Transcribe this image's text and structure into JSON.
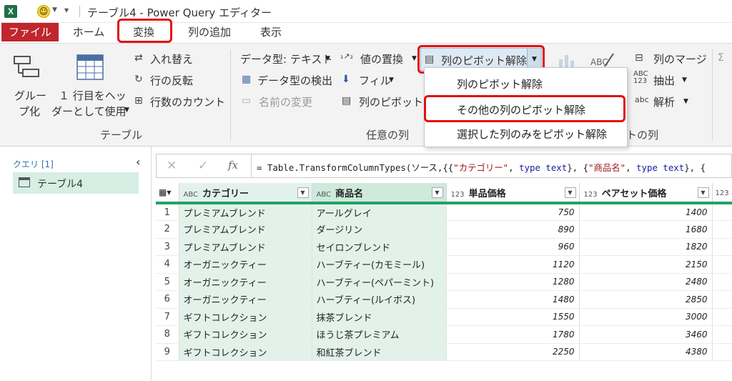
{
  "window": {
    "app_icon": "X",
    "title": "テーブル4 - Power Query エディター"
  },
  "tabs": {
    "file": "ファイル",
    "home": "ホーム",
    "transform": "変換",
    "add_column": "列の追加",
    "view": "表示"
  },
  "ribbon": {
    "group_by_1": "グルー",
    "group_by_2": "プ化",
    "first_row_1": "１ 行目をヘッ",
    "first_row_2": "ダーとして使用",
    "transpose": "入れ替え",
    "reverse_rows": "行の反転",
    "count_rows": "行数のカウント",
    "table_group": "テーブル",
    "data_type": "データ型: テキスト",
    "detect_type": "データ型の検出",
    "rename": "名前の変更",
    "replace_values": "値の置換",
    "fill": "フィル",
    "pivot_column": "列のピボット",
    "any_column_group": "任意の列",
    "unpivot": "列のピボット解除",
    "merge_columns": "列のマージ",
    "extract": "抽出",
    "parse": "解析",
    "text_column_group_partial": "トの列"
  },
  "unpivot_menu": [
    "列のピボット解除",
    "その他の列のピボット解除",
    "選択した列のみをピボット解除"
  ],
  "queries": {
    "label": "クエリ [1]",
    "items": [
      "テーブル4"
    ]
  },
  "formula": {
    "cancel": "✕",
    "confirm": "✓",
    "fx": "fx",
    "prefix": "= Table.TransformColumnTypes(ソース,{{",
    "s1": "\"カテゴリー\"",
    "sep1": ", ",
    "type1": "type text",
    "mid": "}, {",
    "s2": "\"商品名\"",
    "sep2": ", ",
    "type2": "type text",
    "tail": "}, {"
  },
  "table": {
    "columns": [
      {
        "type": "ABC",
        "name": "カテゴリー"
      },
      {
        "type": "123",
        "name": "商品名",
        "type_label": "ABC"
      },
      {
        "type": "123",
        "name": "単品価格"
      },
      {
        "type": "123",
        "name": "ペアセット価格"
      },
      {
        "type": "123",
        "name": ""
      }
    ],
    "rows": [
      [
        "1",
        "プレミアムブレンド",
        "アールグレイ",
        "750",
        "1400"
      ],
      [
        "2",
        "プレミアムブレンド",
        "ダージリン",
        "890",
        "1680"
      ],
      [
        "3",
        "プレミアムブレンド",
        "セイロンブレンド",
        "960",
        "1820"
      ],
      [
        "4",
        "オーガニックティー",
        "ハーブティー(カモミール)",
        "1120",
        "2150"
      ],
      [
        "5",
        "オーガニックティー",
        "ハーブティー(ペパーミント)",
        "1280",
        "2480"
      ],
      [
        "6",
        "オーガニックティー",
        "ハーブティー(ルイボス)",
        "1480",
        "2850"
      ],
      [
        "7",
        "ギフトコレクション",
        "抹茶ブレンド",
        "1550",
        "3000"
      ],
      [
        "8",
        "ギフトコレクション",
        "ほうじ茶プレミアム",
        "1780",
        "3460"
      ],
      [
        "9",
        "ギフトコレクション",
        "和紅茶ブレンド",
        "2250",
        "4380"
      ]
    ]
  }
}
